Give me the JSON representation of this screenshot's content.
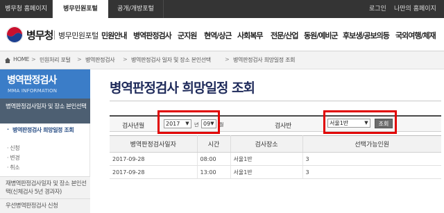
{
  "topbar": {
    "tabs": [
      "병무청 홈페이지",
      "병무민원포털",
      "공개/개방포털"
    ],
    "login": "로그인",
    "my_homepage": "나만의 홈페이지"
  },
  "header": {
    "logo_text": "병무청",
    "logo_sub": "병무민원포털",
    "gnb": [
      "민원안내",
      "병역판정검사",
      "군지원",
      "현역/상근",
      "사회복무",
      "전문/산업",
      "동원/예비군",
      "후보생/공보의등",
      "국외여행/체재"
    ]
  },
  "breadcrumb": [
    "HOME",
    "민원처리 포털",
    "병역판정검사",
    "병역판정검사 일자 및 장소 본인선택",
    "병역판정검사 희망일정 조회"
  ],
  "sidebar": {
    "title": "병역판정검사",
    "subtitle": "MMA INFORMATION",
    "active_item": "병역판정검사일자 및 장소 본인선택",
    "sub_items": [
      "병역판정검사 희망일정 조회",
      "신청",
      "변경",
      "취소"
    ],
    "items": [
      "재병역판정검사일자 및 장소 본인선택(신체검사 5년 경과자)",
      "우선병역판정검사 신청"
    ]
  },
  "main": {
    "title": "병역판정검사 희망일정 조회",
    "search": {
      "year_label": "검사년월",
      "year_value": "2017",
      "year_unit": "년",
      "month_value": "09",
      "month_unit": "월",
      "team_label": "검사반",
      "team_value": "서울1반",
      "search_button": "조회"
    },
    "table": {
      "headers": [
        "병역판정검사일자",
        "시간",
        "검사장소",
        "선택가능인원"
      ],
      "rows": [
        [
          "2017-09-28",
          "08:00",
          "서울1반",
          "3"
        ],
        [
          "2017-09-28",
          "13:00",
          "서울1반",
          "3"
        ]
      ]
    }
  },
  "colors": {
    "topbar_bg": "#343434",
    "sidebar_head": "#3b7dc8",
    "sidebar_active": "#4d5f72",
    "title_color": "#1e2a5a",
    "highlight_red": "#e10000"
  }
}
